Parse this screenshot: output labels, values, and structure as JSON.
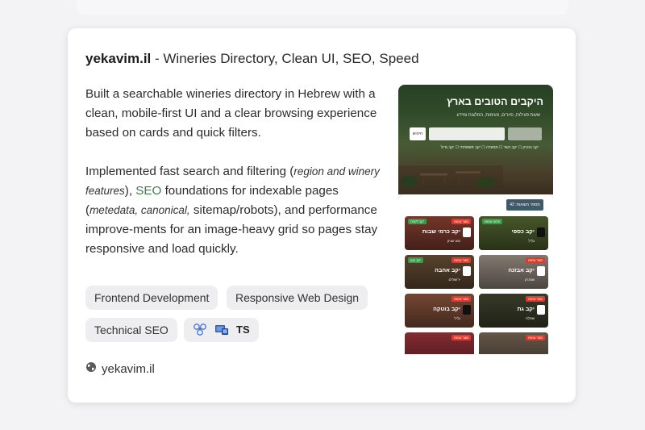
{
  "project": {
    "domain": "yekavim.il",
    "title_rest": " - Wineries Directory, Clean UI, SEO, Speed",
    "description_1": "Built a searchable wineries directory in Hebrew with a clean, mobile-first UI and a clear browsing experience based on cards and quick filters.",
    "d2_a": "Implemented fast search and filtering (",
    "d2_em1": "region and winery features",
    "d2_b": "), ",
    "d2_seo": "SEO",
    "d2_c": " foundations for indexable pages (",
    "d2_em2": "metedata, canonical,",
    "d2_d": " sitemap/robots), and performance improve-ments for an image-heavy grid so pages stay responsive and load quickly.",
    "tags": [
      "Frontend Development",
      "Responsive Web Design",
      "Technical SEO"
    ],
    "tech_icons": [
      "react-query-icon",
      "windows-devices-icon"
    ],
    "tech_label": "TS",
    "link_text": "yekavim.il"
  },
  "preview": {
    "hero_title": "היקבים הטובים בארץ",
    "hero_subtitle": "שעות פעילות, סיורים, טעימות, המלצות ומידע",
    "search_button": "חיפוש",
    "filters": "יקב בוטיק  ☐  יקב כשר  ☐  מסעדה  ☐  יקב משפחתי  ☐  יקב גדול",
    "count_label": "מספר תוצאות: 42",
    "cards": [
      {
        "name": "יקב כרמי שבות",
        "loc": "גוש עציון",
        "badge_red": "סגור עכשיו",
        "badge_green": "יקב לקחת",
        "bg": "#7a3a2c"
      },
      {
        "name": "יקב כספי",
        "loc": "גליל",
        "badge_red": "",
        "badge_green": "פתוח עכשיו",
        "bg": "#4b5b2c"
      },
      {
        "name": "יקב אהבה",
        "loc": "ירושלים",
        "badge_red": "סגור עכשיו",
        "badge_green": "יקב קטן",
        "bg": "#5c4630"
      },
      {
        "name": "יקב אבזנה",
        "loc": "שומרון",
        "badge_red": "סגור עכשיו",
        "badge_green": "",
        "bg": "#8a8076"
      },
      {
        "name": "יקב בוטקה",
        "loc": "גליל",
        "badge_red": "סגור עכשיו",
        "badge_green": "",
        "bg": "#7a4a36"
      },
      {
        "name": "יקב גת",
        "loc": "שפלה",
        "badge_red": "סגור עכשיו",
        "badge_green": "",
        "bg": "#3a3d2a"
      },
      {
        "name": "",
        "loc": "",
        "badge_red": "סגור עכשיו",
        "badge_green": "",
        "bg": "#8a2e35"
      },
      {
        "name": "",
        "loc": "",
        "badge_red": "סגור עכשיו",
        "badge_green": "",
        "bg": "#6a5b4c"
      }
    ]
  }
}
